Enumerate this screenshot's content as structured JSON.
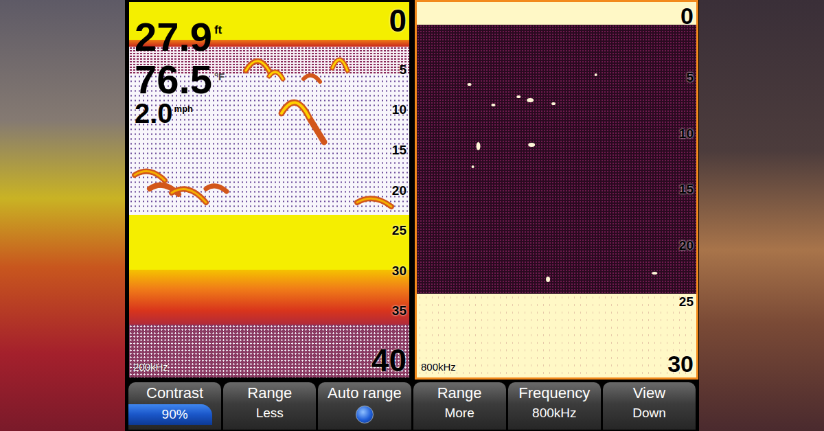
{
  "left_panel": {
    "selected": false,
    "depth": "27.9",
    "depth_unit": "ft",
    "temperature": "76.5",
    "temperature_unit": "°F",
    "speed": "2.0",
    "speed_unit": "mph",
    "frequency": "200kHz",
    "scale": [
      "0",
      "5",
      "10",
      "15",
      "20",
      "25",
      "30",
      "35",
      "40"
    ]
  },
  "right_panel": {
    "selected": true,
    "frequency": "800kHz",
    "scale": [
      "0",
      "5",
      "10",
      "15",
      "20",
      "25",
      "30"
    ]
  },
  "buttons": [
    {
      "label": "Contrast",
      "kind": "slider",
      "value": "90%",
      "level": 0.9
    },
    {
      "label": "Range",
      "kind": "text",
      "value": "Less"
    },
    {
      "label": "Auto range",
      "kind": "toggle",
      "on": true
    },
    {
      "label": "Range",
      "kind": "text",
      "value": "More"
    },
    {
      "label": "Frequency",
      "kind": "text",
      "value": "800kHz"
    },
    {
      "label": "View",
      "kind": "text",
      "value": "Down"
    }
  ]
}
